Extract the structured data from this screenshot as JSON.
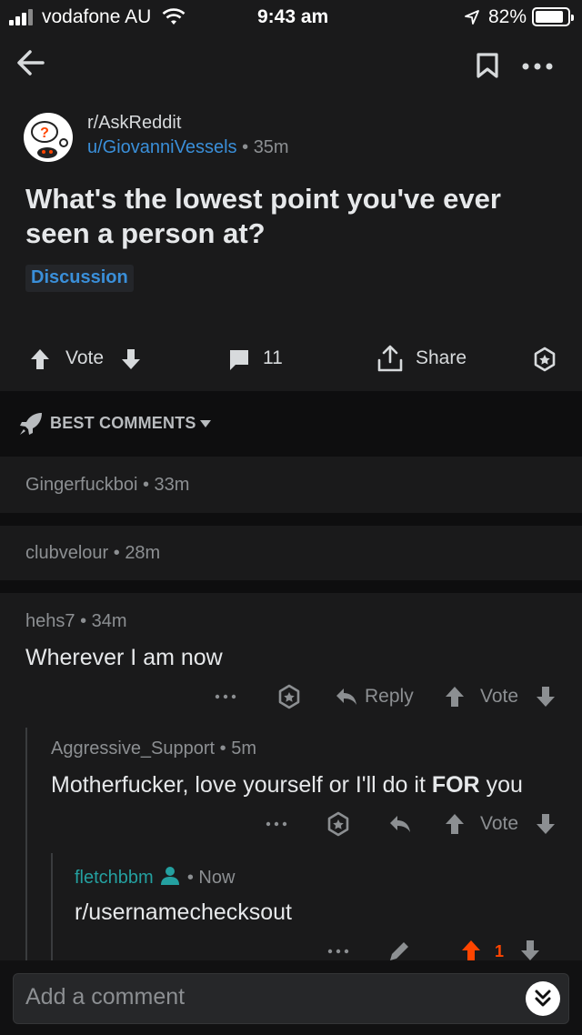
{
  "status_bar": {
    "carrier": "vodafone AU",
    "time": "9:43 am",
    "battery": "82%"
  },
  "post": {
    "subreddit": "r/AskReddit",
    "author": "u/GiovanniVessels",
    "age": "35m",
    "title": "What's the lowest point you've ever seen a person at?",
    "flair": "Discussion",
    "vote_label": "Vote",
    "comment_count": "11",
    "share_label": "Share"
  },
  "sort": {
    "label": "BEST COMMENTS"
  },
  "comments": {
    "collapsed": [
      {
        "author": "Gingerfuckboi",
        "age": "33m"
      },
      {
        "author": "clubvelour",
        "age": "28m"
      }
    ],
    "c1": {
      "author": "hehs7",
      "age": "34m",
      "body": "Wherever I am now",
      "reply_label": "Reply",
      "vote_label": "Vote"
    },
    "c2": {
      "author": "Aggressive_Support",
      "age": "5m",
      "body_pre": "Motherfucker, love yourself or I'll do it ",
      "body_bold": "FOR",
      "body_post": " you",
      "vote_label": "Vote"
    },
    "c3": {
      "author": "fletchbbm",
      "age": "Now",
      "body": "r/usernamechecksout",
      "score": "1"
    }
  },
  "composer": {
    "placeholder": "Add a comment"
  },
  "colors": {
    "background": "#1a1a1b",
    "link_blue": "#3a8fd9",
    "op_green": "#24a0a0",
    "upvote_orange": "#ff4500"
  },
  "separator": "•"
}
